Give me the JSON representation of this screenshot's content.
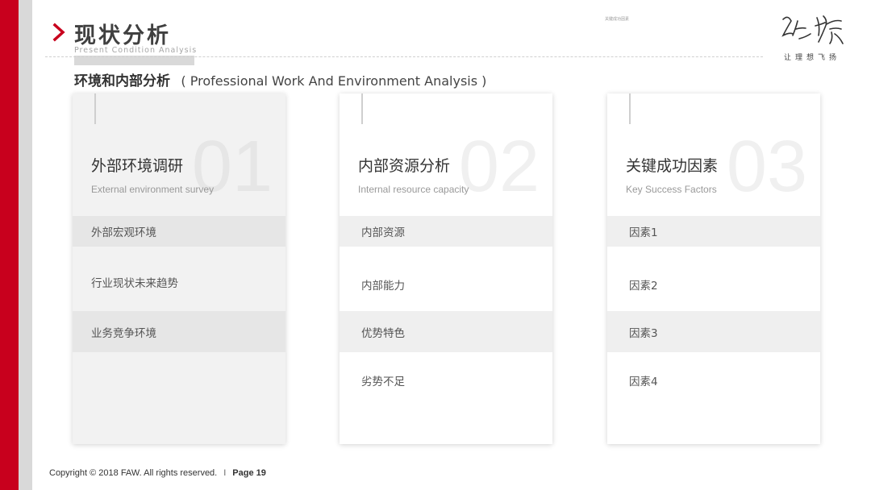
{
  "header": {
    "title_cn": "现状分析",
    "title_en": "Present Condition Analysis",
    "tiny_note": "关键成功因素",
    "logo_text": "红旗",
    "logo_slogan": "让理想飞扬"
  },
  "section": {
    "title_cn": "环境和内部分析",
    "title_en": "( Professional Work And Environment Analysis )"
  },
  "cards": [
    {
      "number": "01",
      "heading": "外部环境调研",
      "subheading": "External environment survey",
      "items": [
        "外部宏观环境",
        "行业现状未来趋势",
        "业务竞争环境"
      ]
    },
    {
      "number": "02",
      "heading": "内部资源分析",
      "subheading": "Internal resource capacity",
      "items": [
        "内部资源",
        "内部能力",
        "优势特色",
        "劣势不足"
      ]
    },
    {
      "number": "03",
      "heading": "关键成功因素",
      "subheading": "Key Success Factors",
      "items": [
        "因素1",
        "因素2",
        "因素3",
        "因素4"
      ]
    }
  ],
  "footer": {
    "copyright": "Copyright © 2018 FAW. All rights reserved.",
    "separator": "I",
    "page": "Page 19"
  },
  "colors": {
    "brand_red": "#c8001d",
    "side_grey": "#d9d9d9"
  }
}
